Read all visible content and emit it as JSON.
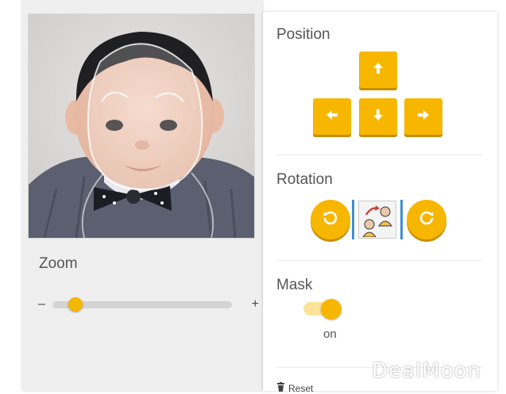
{
  "zoom": {
    "label": "Zoom",
    "minus": "–",
    "plus": "+",
    "level": 0.13
  },
  "position": {
    "title": "Position",
    "icons": [
      "arrow-up-icon",
      "arrow-left-icon",
      "arrow-down-icon",
      "arrow-right-icon"
    ]
  },
  "rotation": {
    "title": "Rotation",
    "icons": [
      "rotate-left-icon",
      "flip-thumbnail",
      "rotate-right-icon"
    ]
  },
  "mask": {
    "title": "Mask",
    "state": "on"
  },
  "reset": {
    "label": "Reset",
    "icon": "trash-icon"
  },
  "watermark": "DealMoon",
  "colors": {
    "accent": "#f7b600",
    "accent_shadow": "#c78f00",
    "toggle_track": "#fde39a",
    "flip_border": "#3d8ed6",
    "panel_bg": "#efefef"
  }
}
